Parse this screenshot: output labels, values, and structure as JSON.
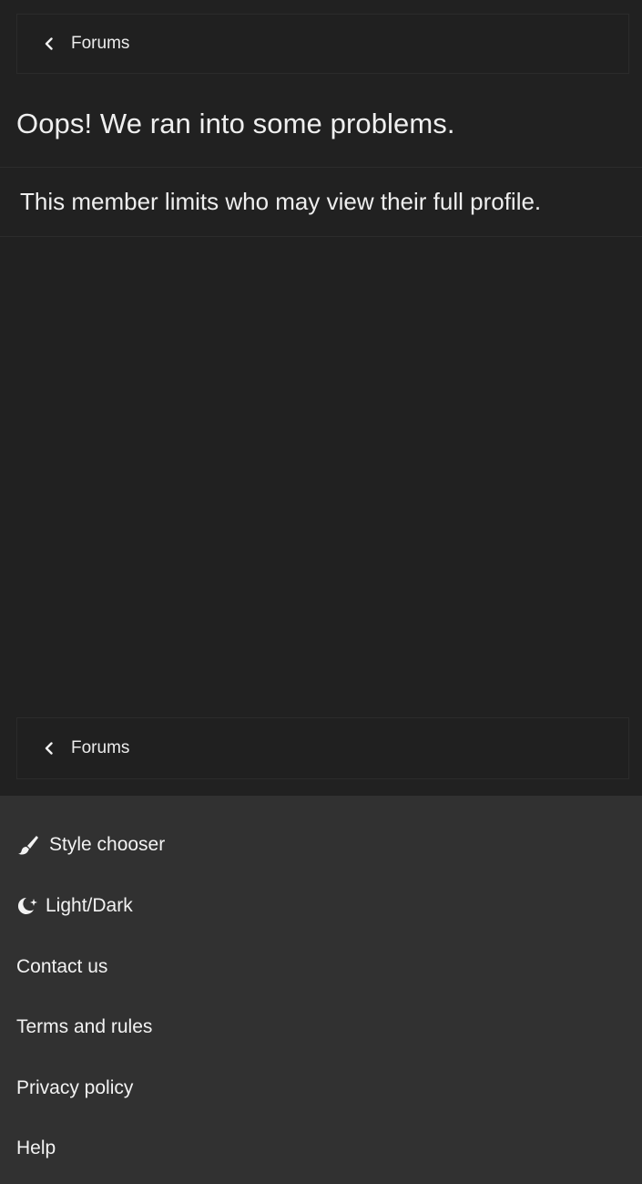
{
  "breadcrumb_top": {
    "label": "Forums",
    "icon": "chevron-left-icon"
  },
  "page_title": "Oops! We ran into some problems.",
  "error_message": "This member limits who may view their full profile.",
  "breadcrumb_bottom": {
    "label": "Forums",
    "icon": "chevron-left-icon"
  },
  "footer": {
    "style_chooser": {
      "label": "Style chooser",
      "icon": "paint-brush-icon"
    },
    "light_dark": {
      "label": "Light/Dark",
      "icon": "moon-sparkle-icon"
    },
    "contact": "Contact us",
    "terms": "Terms and rules",
    "privacy": "Privacy policy",
    "help": "Help"
  },
  "colors": {
    "page_background": "#212121",
    "footer_background": "#313131",
    "text": "#eeeeee"
  }
}
